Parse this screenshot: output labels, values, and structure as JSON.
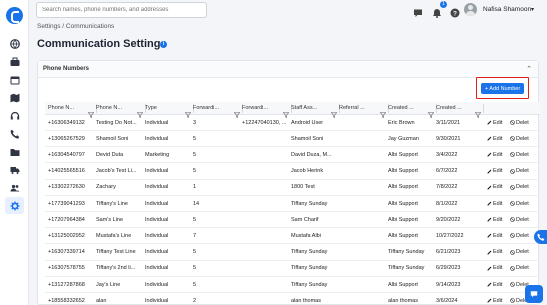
{
  "sidebar": {
    "icons": [
      "logo-icon",
      "globe-icon",
      "briefcase-icon",
      "calendar-icon",
      "map-icon",
      "headset-icon",
      "phone-icon",
      "folder-icon",
      "truck-icon",
      "users-icon",
      "gear-icon"
    ]
  },
  "topbar": {
    "search_placeholder": "Search names, phone numbers, and addresses",
    "notification_count": "1",
    "user_name": "Nafisa Shamoon"
  },
  "breadcrumb": "Settings / Communications",
  "page": {
    "title": "Communication Settings"
  },
  "panel": {
    "title": "Phone Numbers",
    "add_button": "+ Add Number"
  },
  "table": {
    "columns": [
      "Phone N...",
      "Phone N...",
      "Type",
      "Forwardi...",
      "Forwardi...",
      "Staff Ass...",
      "Referral ...",
      "Created ...",
      "Created ..."
    ],
    "action_edit": "Edit",
    "action_delete": "Delet",
    "rows": [
      [
        "+16306349132",
        "Testing Do Not...",
        "Individual",
        "3",
        "+12247040130, ...",
        "Android User",
        "",
        "Eric Brown",
        "3/11/2021"
      ],
      [
        "+13065267529",
        "Shamoil Soni",
        "Individual",
        "5",
        "",
        "Shamoil Soni",
        "",
        "Jay Guzman",
        "9/30/2021"
      ],
      [
        "+16304540797",
        "Devid Duta",
        "Marketing",
        "5",
        "",
        "David Duza, M...",
        "",
        "Albi Support",
        "3/4/2022"
      ],
      [
        "+14025565516",
        "Jacob's Test Li...",
        "Individual",
        "5",
        "",
        "Jacob Herink",
        "",
        "Albi Support",
        "6/7/2022"
      ],
      [
        "+13302272630",
        "Zachary",
        "Individual",
        "1",
        "",
        "1800 Test",
        "",
        "Albi Support",
        "7/8/2022"
      ],
      [
        "+17739041293",
        "Tiffany's Line",
        "Individual",
        "14",
        "",
        "Tiffany Sunday",
        "",
        "Albi Support",
        "8/1/2022"
      ],
      [
        "+17207964384",
        "Sam's Line",
        "Individual",
        "5",
        "",
        "Sam Charif",
        "",
        "Albi Support",
        "9/20/2022"
      ],
      [
        "+13125002952",
        "Mustafa's Line",
        "Individual",
        "7",
        "",
        "Mustafa Albi",
        "",
        "Albi Support",
        "10/27/2022"
      ],
      [
        "+16307339714",
        "Tiffany Test Line",
        "Individual",
        "5",
        "",
        "Tiffany Sunday",
        "",
        "Tiffany Sunday",
        "6/21/2023"
      ],
      [
        "+16307578755",
        "Tiffany's 2nd li...",
        "Individual",
        "5",
        "",
        "Tiffany Sunday",
        "",
        "Tiffany Sunday",
        "6/29/2023"
      ],
      [
        "+13127287868",
        "Jay's Line",
        "Individual",
        "5",
        "",
        "Tiffany Sunday",
        "",
        "Albi Support",
        "9/14/2023"
      ],
      [
        "+18558332652",
        "alan",
        "Individual",
        "2",
        "",
        "alan thomas",
        "",
        "alan thomas",
        "3/6/2024"
      ]
    ]
  }
}
